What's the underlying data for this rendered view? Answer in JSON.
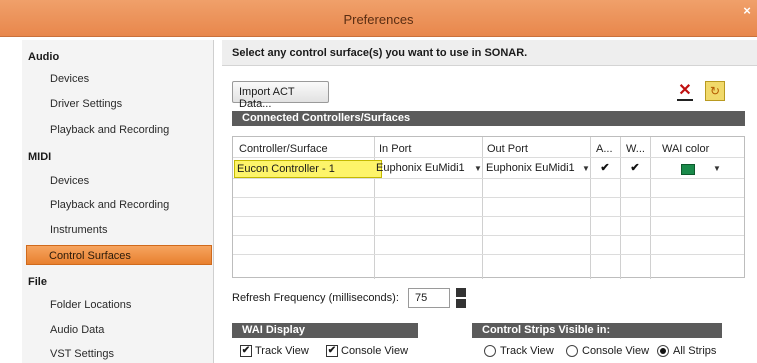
{
  "window": {
    "title": "Preferences",
    "close_glyph": "×"
  },
  "sidebar": {
    "groups": [
      {
        "header": "Audio",
        "items": [
          "Devices",
          "Driver Settings",
          "Playback and Recording"
        ]
      },
      {
        "header": "MIDI",
        "items": [
          "Devices",
          "Playback and Recording",
          "Instruments",
          "Control Surfaces"
        ]
      },
      {
        "header": "File",
        "items": [
          "Folder Locations",
          "Audio Data",
          "VST Settings"
        ]
      }
    ],
    "selected": "Control Surfaces"
  },
  "main": {
    "banner": "Select any control surface(s) you want to use in SONAR.",
    "import_button": "Import ACT Data...",
    "icons": {
      "delete": "delete-icon",
      "refresh": "refresh-icon"
    },
    "connected_title": "Connected Controllers/Surfaces",
    "table": {
      "headers": [
        "Controller/Surface",
        "In Port",
        "Out Port",
        "A...",
        "W...",
        "WAI color"
      ],
      "rows": [
        {
          "controller": "Eucon Controller - 1",
          "in_port": "Euphonix EuMidi1",
          "out_port": "Euphonix EuMidi1",
          "a": true,
          "w": true,
          "wai_color": "#1a8a4a"
        }
      ]
    },
    "refresh": {
      "label": "Refresh Frequency (milliseconds):",
      "value": "75"
    },
    "wai_display": {
      "title": "WAI Display",
      "options": [
        {
          "label": "Track View",
          "checked": true
        },
        {
          "label": "Console View",
          "checked": true
        }
      ]
    },
    "strips_visible": {
      "title": "Control Strips Visible in:",
      "options": [
        {
          "label": "Track View",
          "selected": false
        },
        {
          "label": "Console View",
          "selected": false
        },
        {
          "label": "All Strips",
          "selected": true
        }
      ]
    }
  }
}
